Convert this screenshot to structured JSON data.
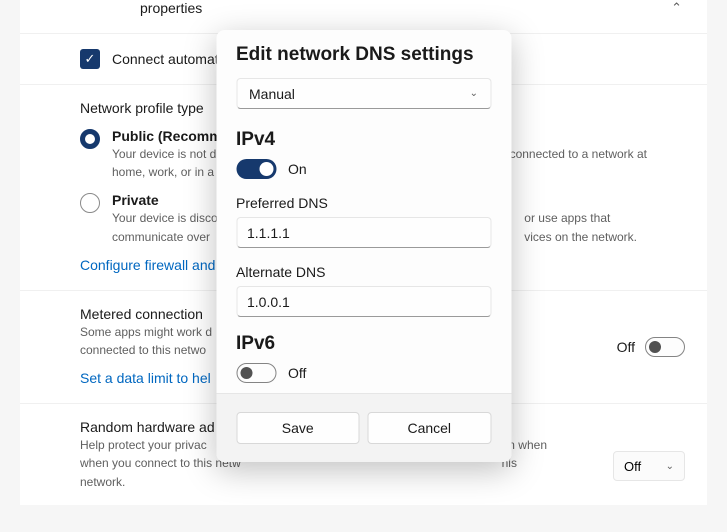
{
  "bg": {
    "properties_label": "properties",
    "connect_auto_label": "Connect automat",
    "profile_type_label": "Network profile type",
    "public": {
      "title": "Public (Recomm",
      "desc_l1": "Your device is not d",
      "desc_l2": "home, work, or in a",
      "desc_r1": "connected to a network at"
    },
    "private": {
      "title": "Private",
      "desc_l1": "Your device is disco",
      "desc_l2": "communicate over",
      "desc_r1": "or use apps that",
      "desc_r2": "vices on the network."
    },
    "configure_firewall_link": "Configure firewall and",
    "metered": {
      "title": "Metered connection",
      "desc_l1": "Some apps might work d",
      "desc_l2": "connected to this netwo",
      "toggle_label": "Off"
    },
    "data_limit_link": "Set a data limit to hel",
    "random_hw": {
      "title": "Random hardware ad",
      "desc_l1": "Help protect your privac",
      "desc_l2": "when you connect to this netw",
      "desc_l3": "network.",
      "desc_r1": "on when",
      "desc_r2": "his",
      "select_value": "Off"
    }
  },
  "dialog": {
    "title": "Edit network DNS settings",
    "mode_value": "Manual",
    "ipv4": {
      "heading": "IPv4",
      "toggle_state": "On",
      "preferred_label": "Preferred DNS",
      "preferred_value": "1.1.1.1",
      "alternate_label": "Alternate DNS",
      "alternate_value": "1.0.0.1"
    },
    "ipv6": {
      "heading": "IPv6",
      "toggle_state": "Off"
    },
    "save_label": "Save",
    "cancel_label": "Cancel"
  }
}
